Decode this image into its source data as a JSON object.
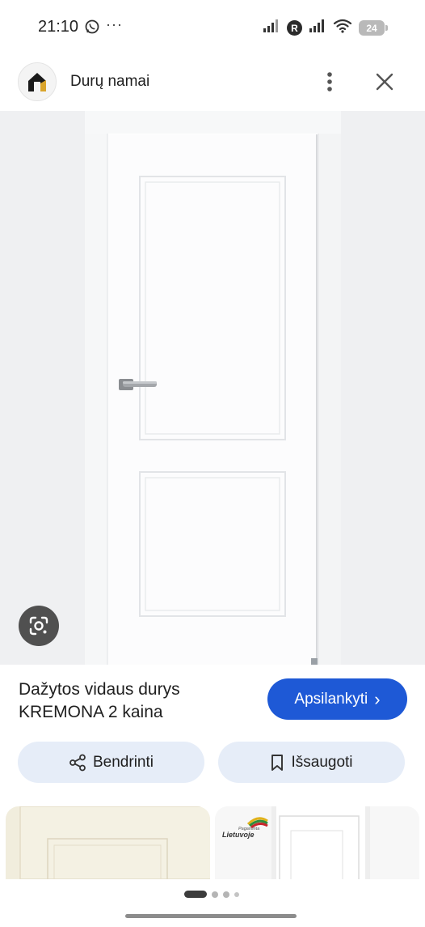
{
  "status": {
    "time": "21:10",
    "more": "···",
    "battery": "24",
    "network_badge": "R"
  },
  "header": {
    "site_name": "Durų namai"
  },
  "product": {
    "title": "Dažytos vidaus durys KREMONA 2 kaina",
    "visit_label": "Apsilankyti",
    "visit_chevron": "›"
  },
  "actions": {
    "share_label": "Bendrinti",
    "save_label": "Išsaugoti"
  },
  "related": {
    "badge_top": "Pagaminta",
    "badge_bottom": "Lietuvoje"
  },
  "colors": {
    "accent": "#1e59d6",
    "action_bg": "#e6edf8",
    "image_bg": "#eff0f2"
  },
  "icons": {
    "whatsapp": "whatsapp-icon",
    "signal": "signal-icon",
    "wifi": "wifi-icon",
    "menu": "more-vert-icon",
    "close": "close-icon",
    "lens": "google-lens-icon",
    "share": "share-icon",
    "bookmark": "bookmark-icon"
  },
  "carousel": {
    "pages": 4,
    "active_index": 0
  }
}
